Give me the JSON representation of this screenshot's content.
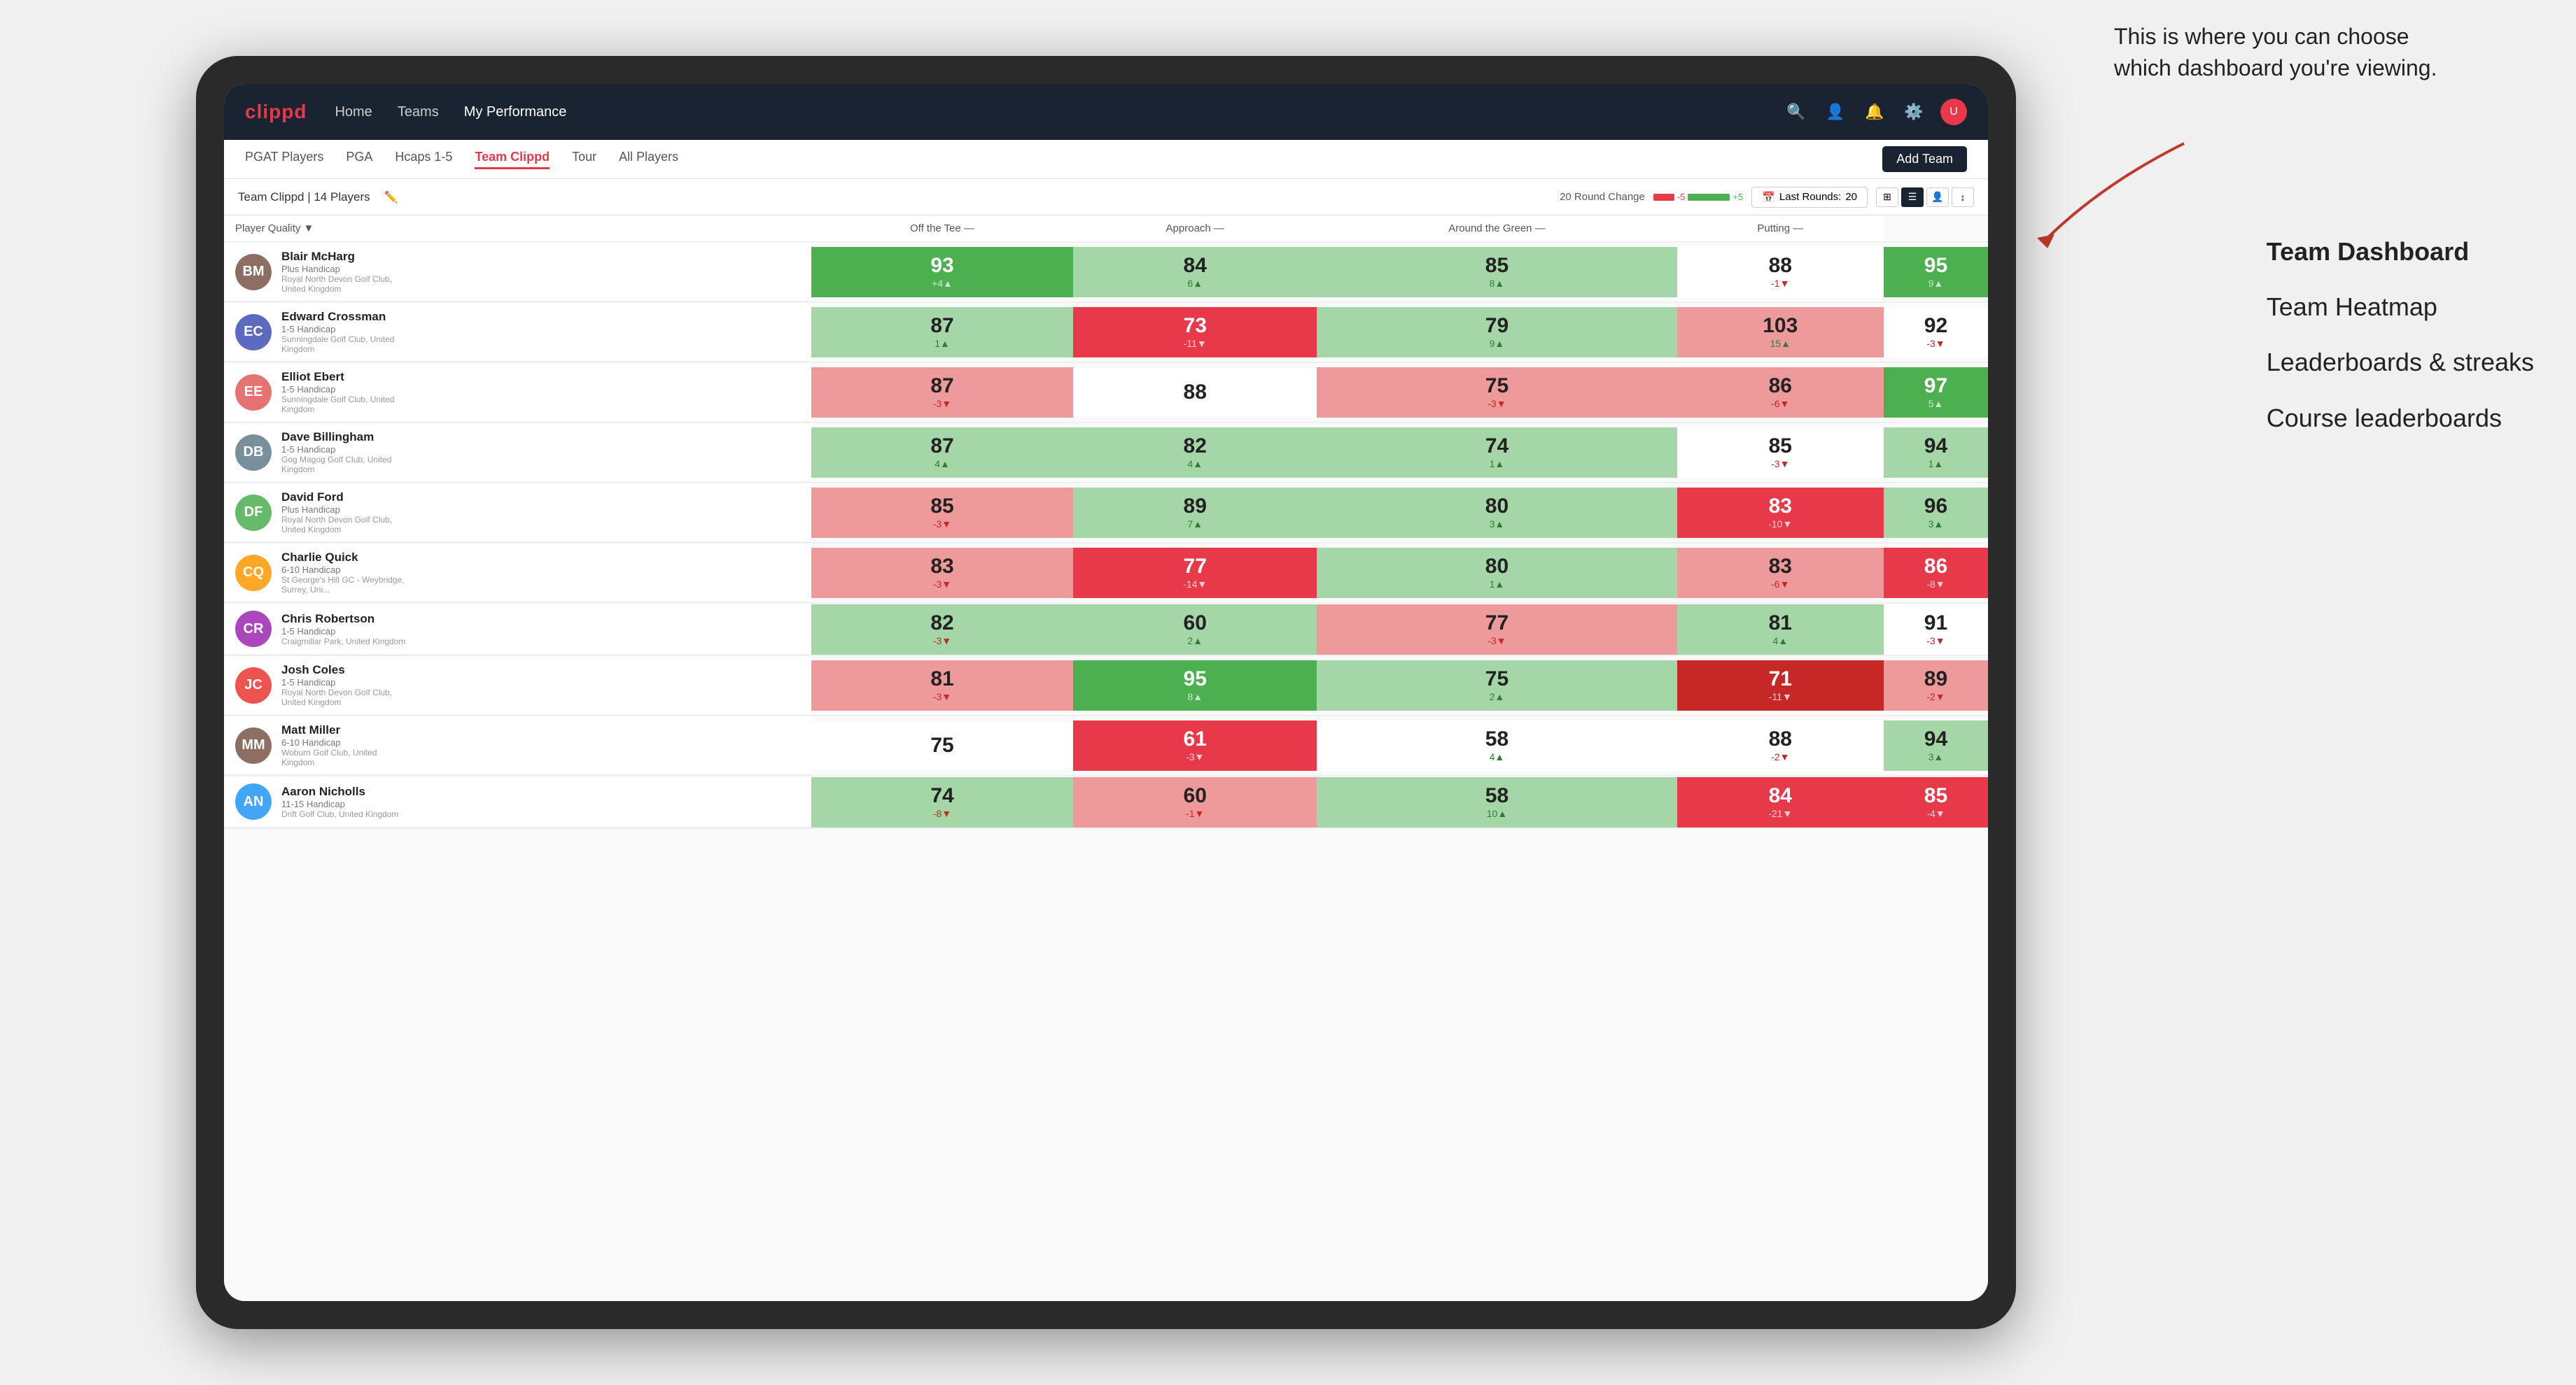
{
  "annotation": {
    "text": "This is where you can choose which dashboard you're viewing.",
    "arrow_label": "arrow"
  },
  "sidebar_labels": {
    "team_dashboard": "Team Dashboard",
    "team_heatmap": "Team Heatmap",
    "leaderboards": "Leaderboards & streaks",
    "course_leaderboards": "Course leaderboards"
  },
  "navbar": {
    "logo": "clippd",
    "links": [
      "Home",
      "Teams",
      "My Performance"
    ],
    "active_link": "My Performance"
  },
  "subnav": {
    "links": [
      "PGAT Players",
      "PGA",
      "Hcaps 1-5",
      "Team Clippd",
      "Tour",
      "All Players"
    ],
    "active_link": "Team Clippd",
    "add_team_label": "Add Team"
  },
  "team_header": {
    "name": "Team Clippd | 14 Players",
    "round_change_label": "20 Round Change",
    "change_neg": "-5",
    "change_pos": "+5",
    "last_rounds_label": "Last Rounds:",
    "last_rounds_value": "20"
  },
  "columns": {
    "player": "Player Quality",
    "off_tee": "Off the Tee",
    "approach": "Approach",
    "around_green": "Around the Green",
    "putting": "Putting"
  },
  "players": [
    {
      "name": "Blair McHarg",
      "handicap": "Plus Handicap",
      "club": "Royal North Devon Golf Club, United Kingdom",
      "avatar_color": "#8d6e63",
      "initials": "BM",
      "quality": {
        "val": 93,
        "change": "+4",
        "dir": "up",
        "bg": "bg-green-med"
      },
      "off_tee": {
        "val": 84,
        "change": "6",
        "dir": "up",
        "bg": "bg-green-light"
      },
      "approach": {
        "val": 85,
        "change": "8",
        "dir": "up",
        "bg": "bg-green-light"
      },
      "around_green": {
        "val": 88,
        "change": "-1",
        "dir": "down",
        "bg": "bg-white"
      },
      "putting": {
        "val": 95,
        "change": "9",
        "dir": "up",
        "bg": "bg-green-med"
      }
    },
    {
      "name": "Edward Crossman",
      "handicap": "1-5 Handicap",
      "club": "Sunningdale Golf Club, United Kingdom",
      "avatar_color": "#5c6bc0",
      "initials": "EC",
      "quality": {
        "val": 87,
        "change": "1",
        "dir": "up",
        "bg": "bg-green-light"
      },
      "off_tee": {
        "val": 73,
        "change": "-11",
        "dir": "down",
        "bg": "bg-red-med"
      },
      "approach": {
        "val": 79,
        "change": "9",
        "dir": "up",
        "bg": "bg-green-light"
      },
      "around_green": {
        "val": 103,
        "change": "15",
        "dir": "up",
        "bg": "bg-red-light"
      },
      "putting": {
        "val": 92,
        "change": "-3",
        "dir": "down",
        "bg": "bg-white"
      }
    },
    {
      "name": "Elliot Ebert",
      "handicap": "1-5 Handicap",
      "club": "Sunningdale Golf Club, United Kingdom",
      "avatar_color": "#e57373",
      "initials": "EE",
      "quality": {
        "val": 87,
        "change": "-3",
        "dir": "down",
        "bg": "bg-red-light"
      },
      "off_tee": {
        "val": 88,
        "change": "",
        "dir": "",
        "bg": "bg-white"
      },
      "approach": {
        "val": 75,
        "change": "-3",
        "dir": "down",
        "bg": "bg-red-light"
      },
      "around_green": {
        "val": 86,
        "change": "-6",
        "dir": "down",
        "bg": "bg-red-light"
      },
      "putting": {
        "val": 97,
        "change": "5",
        "dir": "up",
        "bg": "bg-green-med"
      }
    },
    {
      "name": "Dave Billingham",
      "handicap": "1-5 Handicap",
      "club": "Gog Magog Golf Club, United Kingdom",
      "avatar_color": "#78909c",
      "initials": "DB",
      "quality": {
        "val": 87,
        "change": "4",
        "dir": "up",
        "bg": "bg-green-light"
      },
      "off_tee": {
        "val": 82,
        "change": "4",
        "dir": "up",
        "bg": "bg-green-light"
      },
      "approach": {
        "val": 74,
        "change": "1",
        "dir": "up",
        "bg": "bg-green-light"
      },
      "around_green": {
        "val": 85,
        "change": "-3",
        "dir": "down",
        "bg": "bg-white"
      },
      "putting": {
        "val": 94,
        "change": "1",
        "dir": "up",
        "bg": "bg-green-light"
      }
    },
    {
      "name": "David Ford",
      "handicap": "Plus Handicap",
      "club": "Royal North Devon Golf Club, United Kingdom",
      "avatar_color": "#66bb6a",
      "initials": "DF",
      "quality": {
        "val": 85,
        "change": "-3",
        "dir": "down",
        "bg": "bg-red-light"
      },
      "off_tee": {
        "val": 89,
        "change": "7",
        "dir": "up",
        "bg": "bg-green-light"
      },
      "approach": {
        "val": 80,
        "change": "3",
        "dir": "up",
        "bg": "bg-green-light"
      },
      "around_green": {
        "val": 83,
        "change": "-10",
        "dir": "down",
        "bg": "bg-red-med"
      },
      "putting": {
        "val": 96,
        "change": "3",
        "dir": "up",
        "bg": "bg-green-light"
      }
    },
    {
      "name": "Charlie Quick",
      "handicap": "6-10 Handicap",
      "club": "St George's Hill GC - Weybridge, Surrey, Uni...",
      "avatar_color": "#ffa726",
      "initials": "CQ",
      "quality": {
        "val": 83,
        "change": "-3",
        "dir": "down",
        "bg": "bg-red-light"
      },
      "off_tee": {
        "val": 77,
        "change": "-14",
        "dir": "down",
        "bg": "bg-red-med"
      },
      "approach": {
        "val": 80,
        "change": "1",
        "dir": "up",
        "bg": "bg-green-light"
      },
      "around_green": {
        "val": 83,
        "change": "-6",
        "dir": "down",
        "bg": "bg-red-light"
      },
      "putting": {
        "val": 86,
        "change": "-8",
        "dir": "down",
        "bg": "bg-red-med"
      }
    },
    {
      "name": "Chris Robertson",
      "handicap": "1-5 Handicap",
      "club": "Craigmillar Park, United Kingdom",
      "avatar_color": "#ab47bc",
      "initials": "CR",
      "quality": {
        "val": 82,
        "change": "-3",
        "dir": "down",
        "bg": "bg-green-light"
      },
      "off_tee": {
        "val": 60,
        "change": "2",
        "dir": "up",
        "bg": "bg-green-light"
      },
      "approach": {
        "val": 77,
        "change": "-3",
        "dir": "down",
        "bg": "bg-red-light"
      },
      "around_green": {
        "val": 81,
        "change": "4",
        "dir": "up",
        "bg": "bg-green-light"
      },
      "putting": {
        "val": 91,
        "change": "-3",
        "dir": "down",
        "bg": "bg-white"
      }
    },
    {
      "name": "Josh Coles",
      "handicap": "1-5 Handicap",
      "club": "Royal North Devon Golf Club, United Kingdom",
      "avatar_color": "#ef5350",
      "initials": "JC",
      "quality": {
        "val": 81,
        "change": "-3",
        "dir": "down",
        "bg": "bg-red-light"
      },
      "off_tee": {
        "val": 95,
        "change": "8",
        "dir": "up",
        "bg": "bg-green-med"
      },
      "approach": {
        "val": 75,
        "change": "2",
        "dir": "up",
        "bg": "bg-green-light"
      },
      "around_green": {
        "val": 71,
        "change": "-11",
        "dir": "down",
        "bg": "bg-red-dark"
      },
      "putting": {
        "val": 89,
        "change": "-2",
        "dir": "down",
        "bg": "bg-red-light"
      }
    },
    {
      "name": "Matt Miller",
      "handicap": "6-10 Handicap",
      "club": "Woburn Golf Club, United Kingdom",
      "avatar_color": "#8d6e63",
      "initials": "MM",
      "quality": {
        "val": 75,
        "change": "",
        "dir": "",
        "bg": "bg-white"
      },
      "off_tee": {
        "val": 61,
        "change": "-3",
        "dir": "down",
        "bg": "bg-red-med"
      },
      "approach": {
        "val": 58,
        "change": "4",
        "dir": "up",
        "bg": "bg-white"
      },
      "around_green": {
        "val": 88,
        "change": "-2",
        "dir": "down",
        "bg": "bg-white"
      },
      "putting": {
        "val": 94,
        "change": "3",
        "dir": "up",
        "bg": "bg-green-light"
      }
    },
    {
      "name": "Aaron Nicholls",
      "handicap": "11-15 Handicap",
      "club": "Drift Golf Club, United Kingdom",
      "avatar_color": "#42a5f5",
      "initials": "AN",
      "quality": {
        "val": 74,
        "change": "-8",
        "dir": "down",
        "bg": "bg-green-light"
      },
      "off_tee": {
        "val": 60,
        "change": "-1",
        "dir": "down",
        "bg": "bg-red-light"
      },
      "approach": {
        "val": 58,
        "change": "10",
        "dir": "up",
        "bg": "bg-green-light"
      },
      "around_green": {
        "val": 84,
        "change": "-21",
        "dir": "down",
        "bg": "bg-red-med"
      },
      "putting": {
        "val": 85,
        "change": "-4",
        "dir": "down",
        "bg": "bg-red-med"
      }
    }
  ]
}
